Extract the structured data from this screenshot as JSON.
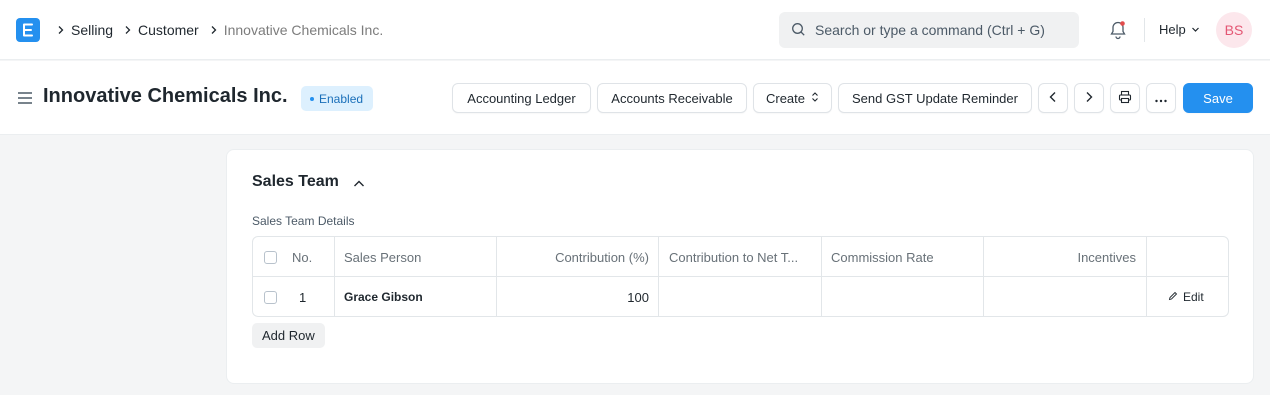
{
  "navbar": {
    "breadcrumbs": [
      "Selling",
      "Customer",
      "Innovative Chemicals Inc."
    ],
    "search_placeholder": "Search or type a command (Ctrl + G)",
    "help_label": "Help",
    "avatar_initials": "BS"
  },
  "page": {
    "title": "Innovative Chemicals Inc.",
    "status": "Enabled",
    "buttons": {
      "accounting_ledger": "Accounting Ledger",
      "accounts_receivable": "Accounts Receivable",
      "create": "Create",
      "send_gst": "Send GST Update Reminder",
      "save": "Save"
    }
  },
  "section": {
    "title": "Sales Team",
    "table_label": "Sales Team Details",
    "columns": [
      "No.",
      "Sales Person",
      "Contribution (%)",
      "Contribution to Net T...",
      "Commission Rate",
      "Incentives"
    ],
    "rows": [
      {
        "no": "1",
        "sales_person": "Grace Gibson",
        "contribution": "100",
        "contribution_net": "",
        "commission_rate": "",
        "incentives": "",
        "edit_label": "Edit"
      }
    ],
    "add_row_label": "Add Row"
  },
  "colors": {
    "accent": "#2490ef",
    "badge_bg": "#ddf0fe",
    "avatar_text": "#e45774"
  }
}
